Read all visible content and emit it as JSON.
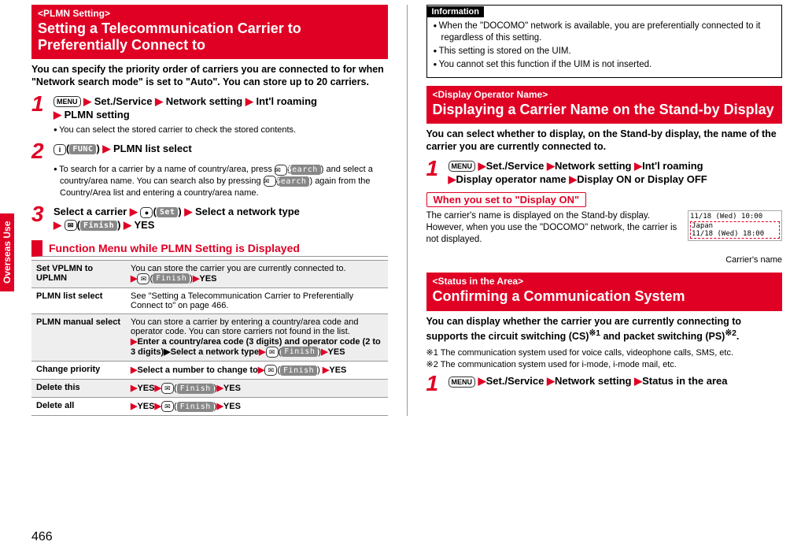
{
  "side_tab": "Overseas Use",
  "page_number": "466",
  "left": {
    "plmn": {
      "pretitle": "<PLMN Setting>",
      "title": "Setting a Telecommunication Carrier to Preferentially Connect to",
      "intro": "You can specify the priority order of carriers you are connected to for when \"Network search mode\" is set to \"Auto\". You can store up to 20 carriers.",
      "step1_menu": "MENU",
      "step1_path": [
        "Set./Service",
        "Network setting",
        "Int'l roaming",
        "PLMN setting"
      ],
      "step1_note": "You can select the stored carrier to check the stored contents.",
      "step2_key": "i",
      "step2_soft": "FUNC",
      "step2_label": "PLMN list select",
      "step2_note_a": "To search for a carrier by a name of country/area, press ",
      "step2_note_mail": "✉",
      "step2_note_search": "Search",
      "step2_note_b": " and select a country/area name. You can search also by pressing ",
      "step2_note_c": " again from the Country/Area list and entering a country/area name.",
      "step3_a": "Select a carrier",
      "step3_center": "●",
      "step3_set": "Set",
      "step3_b": "Select a network type",
      "step3_mail": "✉",
      "step3_finish": "Finish",
      "step3_yes": "YES"
    },
    "fn_header": "Function Menu while PLMN Setting is Displayed",
    "fn_rows": [
      {
        "name": "Set VPLMN to UPLMN",
        "desc_pre": "You can store the carrier you are currently connected to.",
        "actions": [
          "mail",
          "Finish",
          "YES"
        ]
      },
      {
        "name": "PLMN list select",
        "desc": "See \"Setting a Telecommunication Carrier to Preferentially Connect to\" on page 466."
      },
      {
        "name": "PLMN manual select",
        "desc_pre": "You can store a carrier by entering a country/area code and operator code. You can store carriers not found in the list.",
        "bold": "Enter a country/area code (3 digits) and operator code (2 to 3 digits)▶Select a network type",
        "actions": [
          "mail",
          "Finish",
          "YES"
        ]
      },
      {
        "name": "Change priority",
        "bold": "Select a number to change to",
        "actions": [
          "mail",
          "Finish",
          "YES"
        ]
      },
      {
        "name": "Delete this",
        "pre": "YES",
        "actions": [
          "mail",
          "Finish",
          "YES"
        ]
      },
      {
        "name": "Delete all",
        "pre": "YES",
        "actions": [
          "mail",
          "Finish",
          "YES"
        ]
      }
    ]
  },
  "right": {
    "info": {
      "label": "Information",
      "items": [
        "When the \"DOCOMO\" network is available, you are preferentially connected to it regardless of this setting.",
        "This setting is stored on the UIM.",
        "You cannot set this function if the UIM is not inserted."
      ]
    },
    "display": {
      "pretitle": "<Display Operator Name>",
      "title": "Displaying a Carrier Name on the Stand-by Display",
      "intro": "You can select whether to display, on the Stand-by display, the name of the carrier you are currently connected to.",
      "step1_path": [
        "Set./Service",
        "Network setting",
        "Int'l roaming",
        "Display operator name",
        "Display ON or Display OFF"
      ],
      "sub_title": "When you set to \"Display ON\"",
      "sub_text": "The carrier's name is displayed on the Stand-by display. However, when you use the \"DOCOMO\" network, the carrier is not displayed.",
      "preview": {
        "line1": "11/18 (Wed) 10:00",
        "line2a": "Japan",
        "line2b": "11/18 (Wed) 18:00"
      },
      "caption": "Carrier's name"
    },
    "status": {
      "pretitle": "<Status in the Area>",
      "title": "Confirming a Communication System",
      "intro_a": "You can display whether the carrier you are currently connecting to supports the circuit switching (CS)",
      "intro_b": " and packet switching (PS)",
      "intro_c": ".",
      "fn1_mark": "※1",
      "fn2_mark": "※2",
      "fn1": "The communication system used for voice calls, videophone calls, SMS, etc.",
      "fn2": "The communication system used for i-mode, i-mode mail, etc.",
      "step1_path": [
        "Set./Service",
        "Network setting",
        "Status in the area"
      ]
    }
  }
}
